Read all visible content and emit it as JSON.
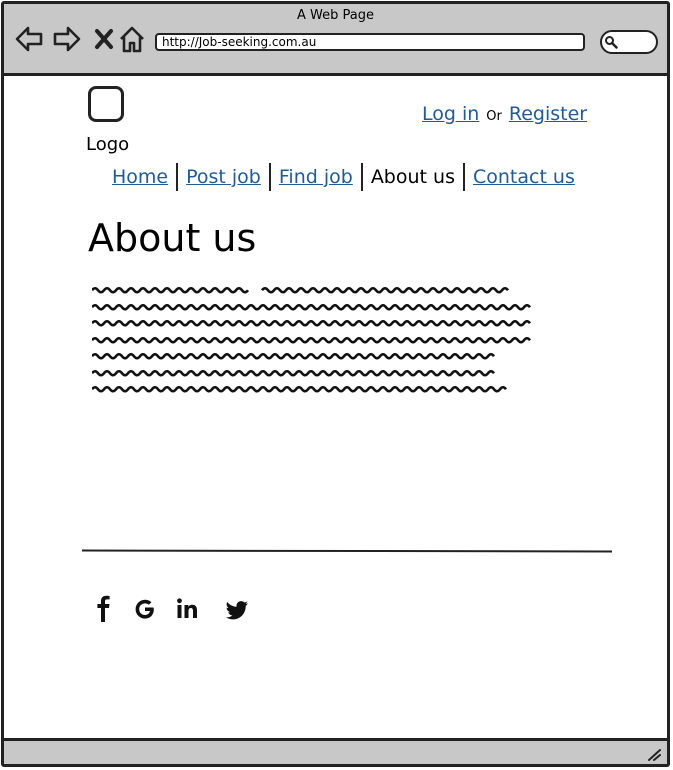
{
  "window": {
    "title": "A Web Page"
  },
  "address_bar": {
    "url": "http://Job-seeking.com.au"
  },
  "icons": {
    "back": "back-arrow-icon",
    "forward": "forward-arrow-icon",
    "stop": "close-icon",
    "home": "home-icon",
    "search": "search-icon",
    "resize": "resize-grip-icon"
  },
  "header": {
    "logo_label": "Logo",
    "login_label": "Log in",
    "or_label": "Or",
    "register_label": "Register"
  },
  "nav": {
    "items": [
      {
        "label": "Home",
        "active": false
      },
      {
        "label": "Post job",
        "active": false
      },
      {
        "label": "Find job",
        "active": false
      },
      {
        "label": "About us",
        "active": true
      },
      {
        "label": "Contact us",
        "active": false
      }
    ]
  },
  "main": {
    "title": "About us",
    "body_lines": 7
  },
  "footer": {
    "social": [
      "facebook-icon",
      "google-icon",
      "linkedin-icon",
      "twitter-icon"
    ]
  },
  "colors": {
    "link": "#1f5b9b",
    "chrome": "#c8c8c8",
    "ink": "#222222"
  }
}
